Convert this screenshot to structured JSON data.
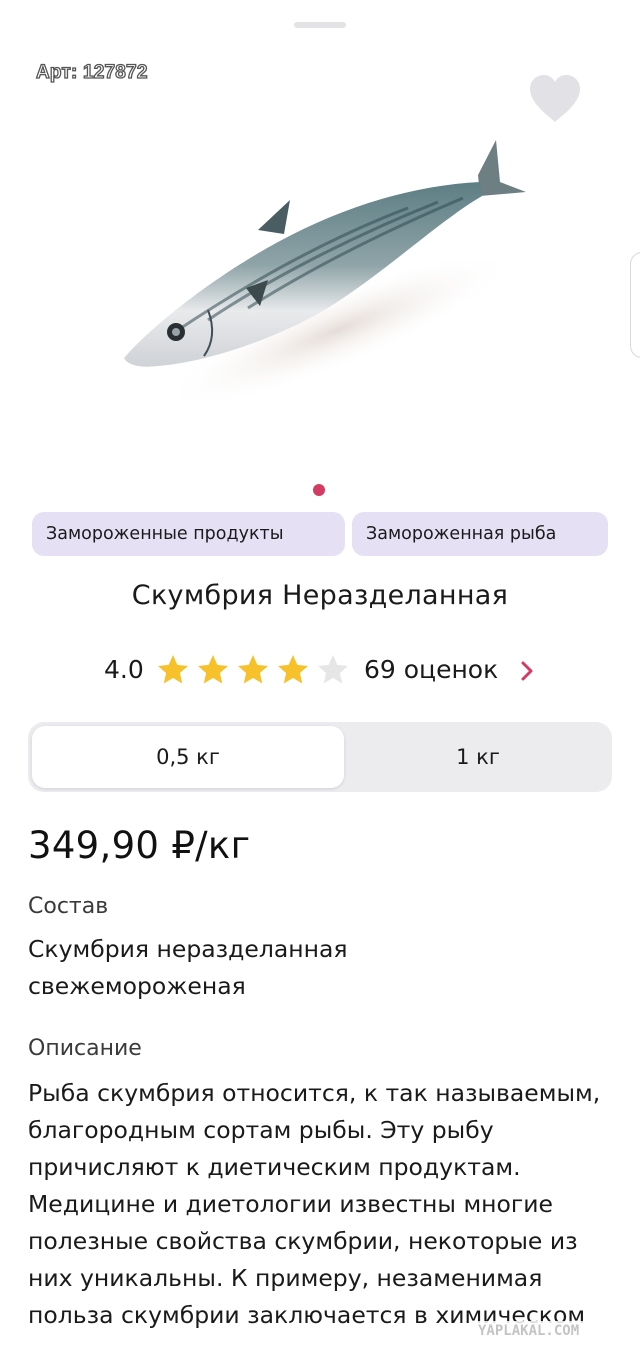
{
  "product": {
    "sku": "Арт: 127872",
    "title": "Скумбрия Неразделанная",
    "price": "349,90 ₽/кг"
  },
  "categories": [
    "Замороженные продукты",
    "Замороженная рыба"
  ],
  "rating": {
    "value": "4.0",
    "stars_filled": 4,
    "stars_total": 5,
    "count_label": "69 оценок"
  },
  "weights": {
    "options": [
      "0,5 кг",
      "1 кг"
    ],
    "selected": "0,5 кг"
  },
  "composition": {
    "label": "Состав",
    "text": "Скумбрия неразделанная свежемороженая"
  },
  "description": {
    "label": "Описание",
    "text": "Рыба скумбрия относится, к так называемым, благородным сортам рыбы. Эту рыбу причисляют к диетическим продуктам. Медицине и диетологии известны многие полезные свойства скумбрии, некоторые из них уникальны. К примеру, незаменимая польза скумбрии заключается в химическом"
  },
  "watermark": "YAPLAKAL.COM",
  "colors": {
    "accent": "#d43b62",
    "chip_bg": "#e6e0f5",
    "star": "#f7c12b",
    "star_empty": "#e6e6e6",
    "segment_bg": "#ececef"
  },
  "icons": {
    "favorite": "heart-icon",
    "rating": "star-icon",
    "more": "chevron-right-icon"
  }
}
